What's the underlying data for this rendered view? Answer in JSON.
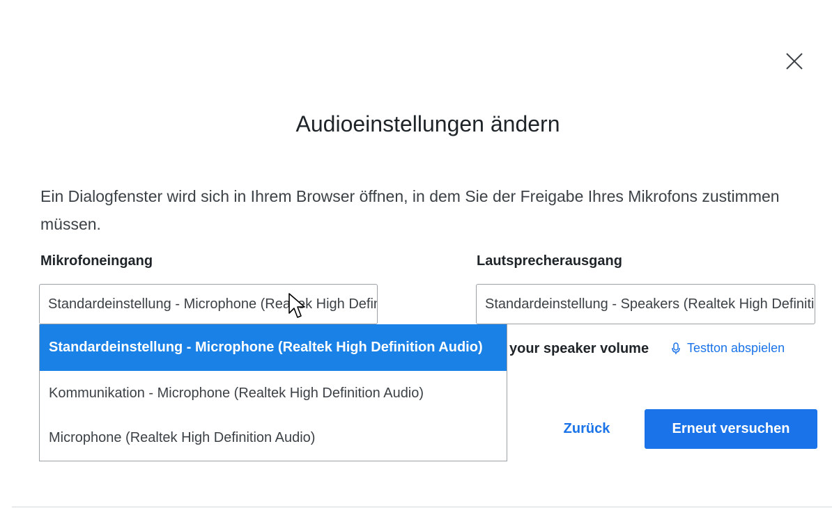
{
  "dialog": {
    "title": "Audioeinstellungen ändern",
    "description": "Ein Dialogfenster wird sich in Ihrem Browser öffnen, in dem Sie der Freigabe Ihres Mikrofons zustimmen müssen.",
    "close_icon": "close-icon"
  },
  "microphone": {
    "label": "Mikrofoneingang",
    "selected_value": "Standardeinstellung - Microphone (Realtek High Definition Audio)",
    "options": [
      "Standardeinstellung - Microphone (Realtek High Definition Audio)",
      "Kommunikation - Microphone (Realtek High Definition Audio)",
      "Microphone (Realtek High Definition Audio)"
    ],
    "highlighted_option_index": 0
  },
  "speaker": {
    "label": "Lautsprecherausgang",
    "selected_value": "Standardeinstellung - Speakers (Realtek High Definition Audio)",
    "volume_hint": "your speaker volume",
    "test_tone_label": "Testton abspielen",
    "test_tone_icon": "microphone-icon"
  },
  "actions": {
    "back_label": "Zurück",
    "retry_label": "Erneut versuchen"
  },
  "colors": {
    "accent": "#1a73e8",
    "selected_option_bg": "#1a81e7",
    "text": "#1f2429"
  }
}
